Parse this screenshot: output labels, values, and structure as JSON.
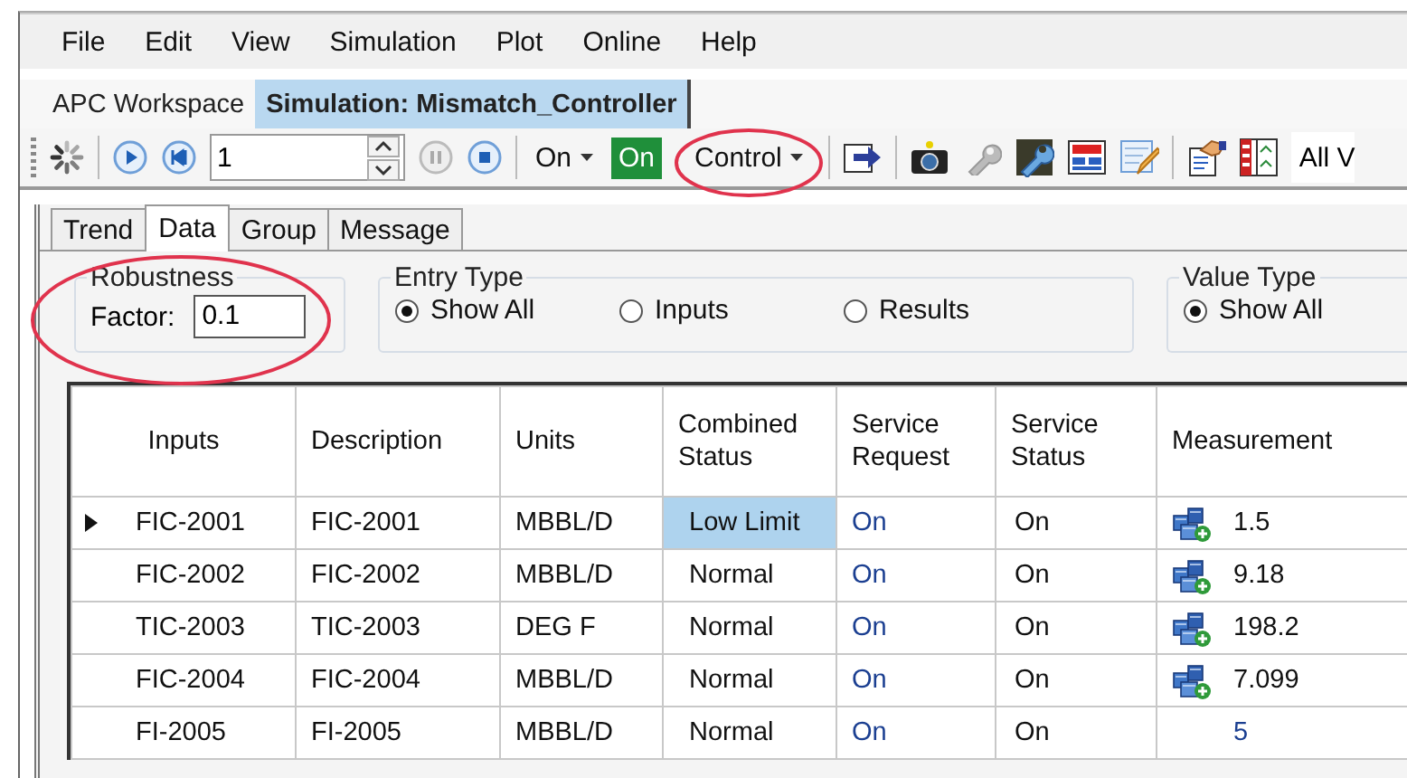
{
  "menu": [
    "File",
    "Edit",
    "View",
    "Simulation",
    "Plot",
    "Online",
    "Help"
  ],
  "workspace_tabs": [
    {
      "label": "APC Workspace",
      "selected": false
    },
    {
      "label": "Simulation: Mismatch_Controller",
      "selected": true
    }
  ],
  "toolbar": {
    "step_value": "1",
    "mode": "On",
    "status": "On",
    "control": "Control",
    "control_circled": true,
    "view": "All V"
  },
  "panel_tabs": [
    {
      "label": "Trend",
      "selected": false
    },
    {
      "label": "Data",
      "selected": true
    },
    {
      "label": "Group",
      "selected": false
    },
    {
      "label": "Message",
      "selected": false
    }
  ],
  "robustness": {
    "title": "Robustness",
    "label": "Factor:",
    "value": "0.1",
    "circled": true
  },
  "entry_type": {
    "title": "Entry Type",
    "options": [
      {
        "label": "Show All",
        "selected": true
      },
      {
        "label": "Inputs",
        "selected": false
      },
      {
        "label": "Results",
        "selected": false
      }
    ]
  },
  "value_type": {
    "title": "Value Type",
    "options": [
      {
        "label": "Show All",
        "selected": true
      }
    ]
  },
  "table": {
    "columns": [
      "Inputs",
      "Description",
      "Units",
      "Combined Status",
      "Service Request",
      "Service Status",
      "Measurement"
    ],
    "rows": [
      {
        "current": true,
        "input": "FIC-2001",
        "description": "FIC-2001",
        "units": "MBBL/D",
        "combined_status": "Low Limit",
        "highlighted": true,
        "service_request": "On",
        "service_status": "On",
        "measurement": "1.5",
        "icon": true,
        "linked": false
      },
      {
        "current": false,
        "input": "FIC-2002",
        "description": "FIC-2002",
        "units": "MBBL/D",
        "combined_status": "Normal",
        "highlighted": false,
        "service_request": "On",
        "service_status": "On",
        "measurement": "9.18",
        "icon": true,
        "linked": false
      },
      {
        "current": false,
        "input": "TIC-2003",
        "description": "TIC-2003",
        "units": "DEG F",
        "combined_status": "Normal",
        "highlighted": false,
        "service_request": "On",
        "service_status": "On",
        "measurement": "198.2",
        "icon": true,
        "linked": false
      },
      {
        "current": false,
        "input": "FIC-2004",
        "description": "FIC-2004",
        "units": "MBBL/D",
        "combined_status": "Normal",
        "highlighted": false,
        "service_request": "On",
        "service_status": "On",
        "measurement": "7.099",
        "icon": true,
        "linked": false
      },
      {
        "current": false,
        "input": "FI-2005",
        "description": "FI-2005",
        "units": "MBBL/D",
        "combined_status": "Normal",
        "highlighted": false,
        "service_request": "On",
        "service_status": "On",
        "measurement": "5",
        "icon": false,
        "linked": true
      }
    ]
  }
}
